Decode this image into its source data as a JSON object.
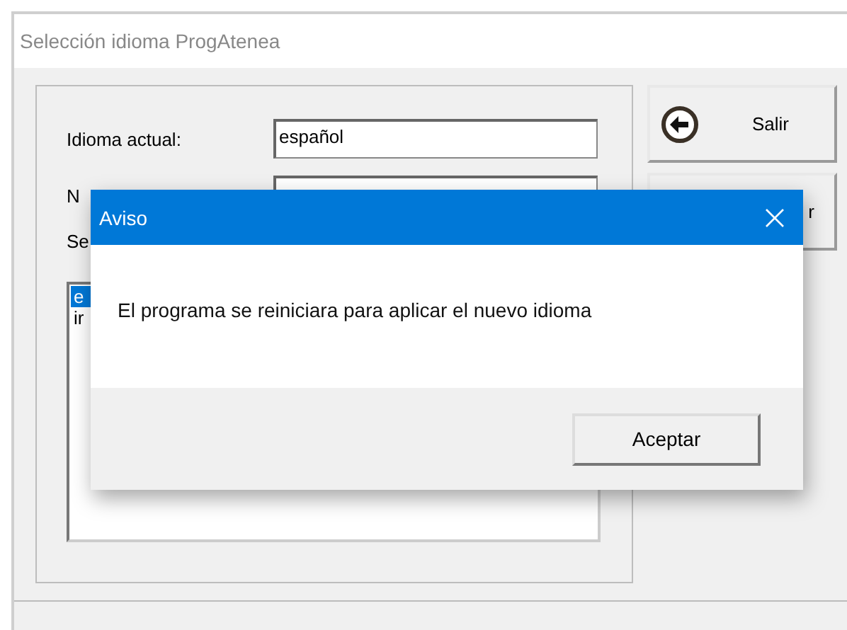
{
  "window": {
    "title": "Selección idioma ProgAtenea"
  },
  "form": {
    "rows": [
      {
        "label": "Idioma actual:",
        "value": "español"
      },
      {
        "label": "N"
      }
    ],
    "list_label": "Se",
    "list_items": [
      {
        "text": "e",
        "selected": true
      },
      {
        "text": "ir",
        "selected": false
      }
    ]
  },
  "buttons": [
    {
      "label": "Salir",
      "kind": "back"
    },
    {
      "label": "r",
      "kind": "plain"
    }
  ],
  "dialog": {
    "title": "Aviso",
    "message": "El programa se reiniciara para aplicar el nuevo idioma",
    "button": "Aceptar"
  }
}
